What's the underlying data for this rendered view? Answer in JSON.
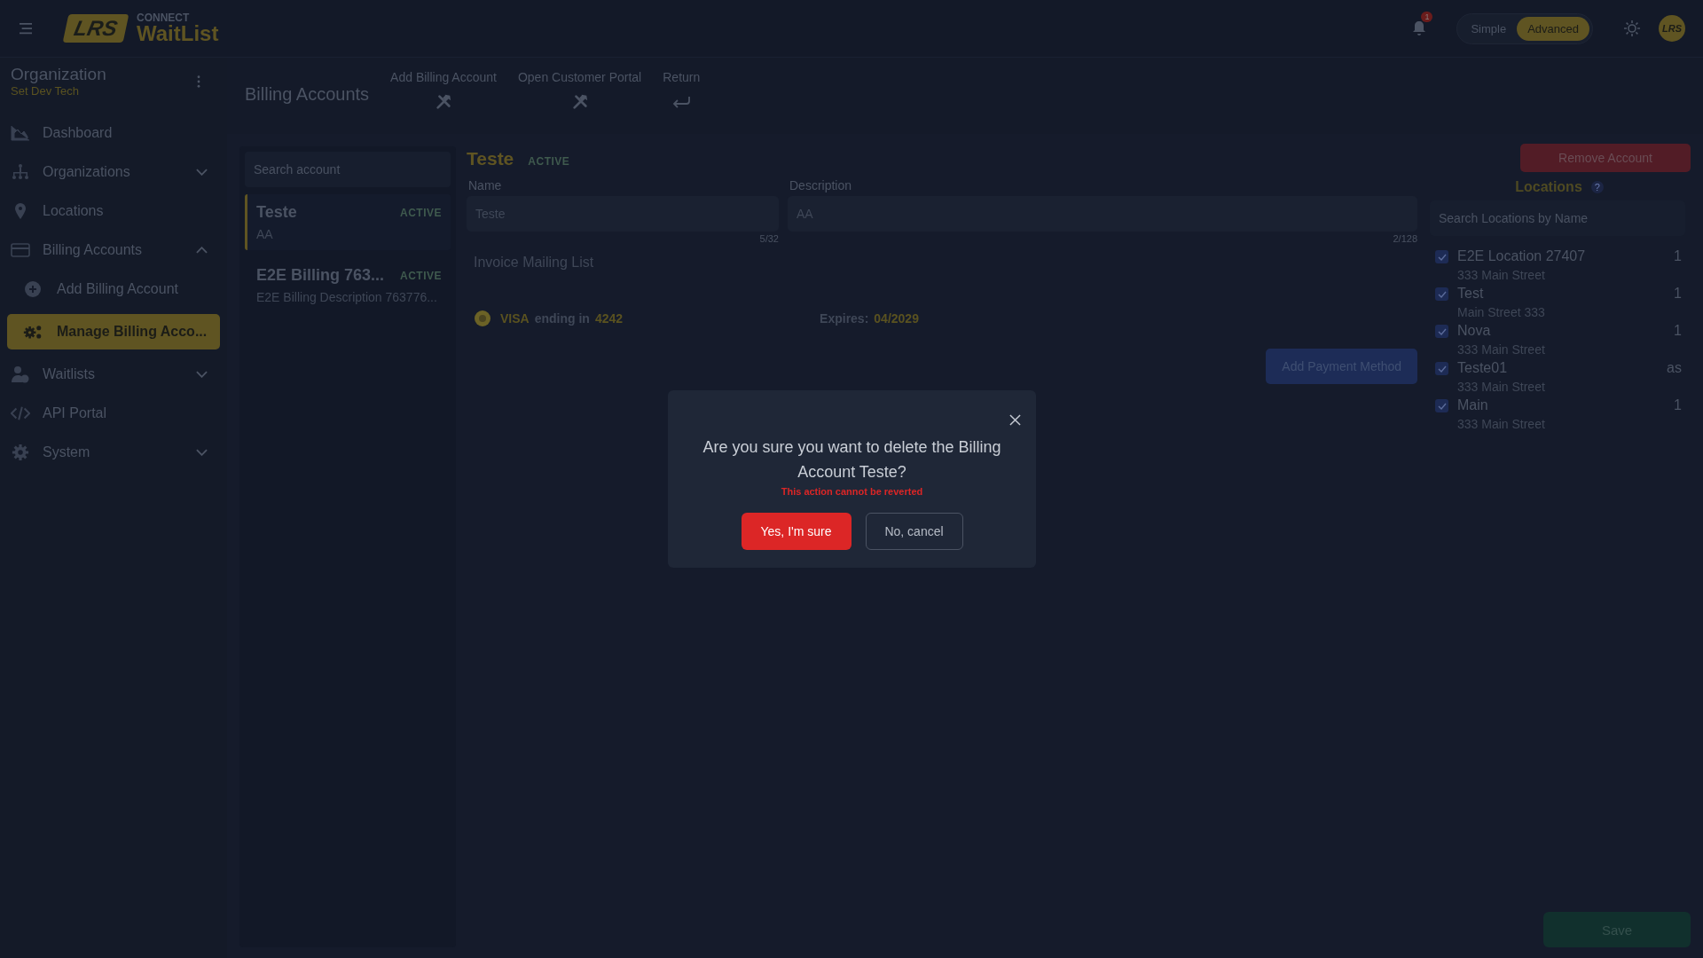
{
  "header": {
    "logo": "LRS",
    "brand_small": "CONNECT",
    "brand": "WaitList",
    "notification_count": "1",
    "modes": [
      {
        "label": "Simple",
        "selected": false
      },
      {
        "label": "Advanced",
        "selected": true
      }
    ],
    "avatar": "LRS"
  },
  "sidebar": {
    "org_label": "Organization",
    "org_name": "Set Dev Tech",
    "items": [
      {
        "kind": "link",
        "label": "Dashboard"
      },
      {
        "kind": "group",
        "label": "Organizations",
        "expanded": false
      },
      {
        "kind": "link",
        "label": "Locations"
      },
      {
        "kind": "group",
        "label": "Billing Accounts",
        "expanded": true,
        "children": [
          {
            "label": "Add Billing Account",
            "selected": false
          },
          {
            "label": "Manage Billing Acco...",
            "selected": true
          }
        ]
      },
      {
        "kind": "group",
        "label": "Waitlists",
        "expanded": false
      },
      {
        "kind": "link",
        "label": "API Portal"
      },
      {
        "kind": "group",
        "label": "System",
        "expanded": false
      }
    ]
  },
  "page": {
    "title": "Billing Accounts",
    "actions": [
      {
        "label": "Add Billing Account"
      },
      {
        "label": "Open Customer Portal"
      },
      {
        "label": "Return"
      }
    ]
  },
  "accounts": {
    "search": {
      "placeholder": "Search account"
    },
    "items": [
      {
        "name": "Teste",
        "status": "ACTIVE",
        "description": "AA",
        "selected": true
      },
      {
        "name": "E2E Billing 763...",
        "status": "ACTIVE",
        "description": "E2E Billing Description 763776...",
        "selected": false
      }
    ]
  },
  "detail": {
    "name": "Teste",
    "status": "ACTIVE",
    "fields": [
      {
        "label": "Name",
        "value": "Teste",
        "counter": "5/32"
      },
      {
        "label": "Description",
        "value": "AA",
        "counter": "2/128"
      }
    ],
    "mailing_list_label": "Invoice Mailing List",
    "payment": {
      "brand": "VISA",
      "ending_label": "ending in",
      "last4": "4242",
      "expires_label": "Expires:",
      "expires": "04/2029"
    },
    "add_payment_button": "Add Payment Method"
  },
  "remove_button": "Remove Account",
  "locations": {
    "title": "Locations",
    "help": "?",
    "search": {
      "placeholder": "Search Locations by Name"
    },
    "items": [
      {
        "name": "E2E Location 27407",
        "address": "333 Main Street",
        "value": "1",
        "checked": true
      },
      {
        "name": "Test",
        "address": "Main Street 333",
        "value": "1",
        "checked": true
      },
      {
        "name": "Nova",
        "address": "333 Main Street",
        "value": "1",
        "checked": true
      },
      {
        "name": "Teste01",
        "address": "333 Main Street",
        "value": "as",
        "checked": true
      },
      {
        "name": "Main",
        "address": "333 Main Street",
        "value": "1",
        "checked": true
      }
    ]
  },
  "save_button": "Save",
  "modal": {
    "message": "Are you sure you want to delete the Billing Account Teste?",
    "warning": "This action cannot be reverted",
    "confirm_button": "Yes, I'm sure",
    "cancel_button": "No, cancel"
  }
}
